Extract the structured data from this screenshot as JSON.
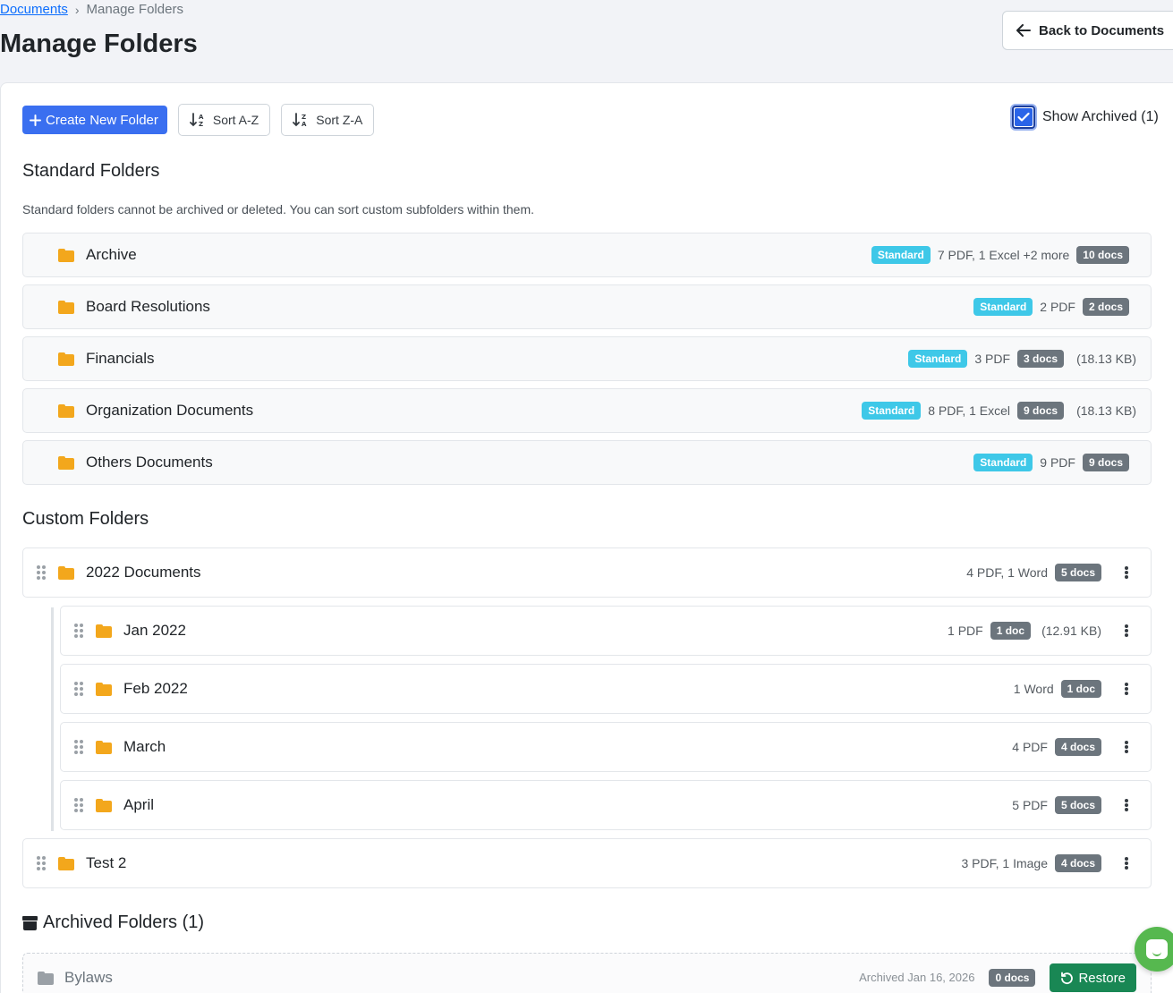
{
  "breadcrumb": {
    "link": "Documents",
    "separator": "›",
    "current": "Manage Folders"
  },
  "page_title": "Manage Folders",
  "back_button": "Back to Documents",
  "toolbar": {
    "create": "Create New Folder",
    "sort_az": "Sort A-Z",
    "sort_za": "Sort Z-A"
  },
  "show_archived": {
    "label": "Show Archived (1)",
    "checked": true
  },
  "standard": {
    "title": "Standard Folders",
    "help": "Standard folders cannot be archived or deleted. You can sort custom subfolders within them.",
    "badge": "Standard",
    "folders": [
      {
        "name": "Archive",
        "summary": "7 PDF, 1 Excel +2 more",
        "count": "10 docs",
        "size": ""
      },
      {
        "name": "Board Resolutions",
        "summary": "2 PDF",
        "count": "2 docs",
        "size": ""
      },
      {
        "name": "Financials",
        "summary": "3 PDF",
        "count": "3 docs",
        "size": "(18.13 KB)"
      },
      {
        "name": "Organization Documents",
        "summary": "8 PDF, 1 Excel",
        "count": "9 docs",
        "size": "(18.13 KB)"
      },
      {
        "name": "Others Documents",
        "summary": "9 PDF",
        "count": "9 docs",
        "size": ""
      }
    ]
  },
  "custom": {
    "title": "Custom Folders",
    "folders": [
      {
        "name": "2022 Documents",
        "summary": "4 PDF, 1 Word",
        "count": "5 docs",
        "size": ""
      },
      {
        "name": "Jan 2022",
        "summary": "1 PDF",
        "count": "1 doc",
        "size": "(12.91 KB)"
      },
      {
        "name": "Feb 2022",
        "summary": "1 Word",
        "count": "1 doc",
        "size": ""
      },
      {
        "name": "March",
        "summary": "4 PDF",
        "count": "4 docs",
        "size": ""
      },
      {
        "name": "April",
        "summary": "5 PDF",
        "count": "5 docs",
        "size": ""
      },
      {
        "name": "Test 2",
        "summary": "3 PDF, 1 Image",
        "count": "4 docs",
        "size": ""
      }
    ]
  },
  "archived": {
    "title": "Archived Folders (1)",
    "folders": [
      {
        "name": "Bylaws",
        "archived_on": "Archived Jan 16, 2026",
        "count": "0 docs",
        "restore": "Restore"
      }
    ]
  },
  "colors": {
    "primary": "#3a6ff0",
    "standard_badge": "#3ec8e8",
    "doc_badge": "#6c757d",
    "folder": "#f3a71c",
    "restore": "#198754"
  },
  "icons": [
    "arrow-left-icon",
    "plus-icon",
    "sort-az-icon",
    "sort-za-icon",
    "folder-icon",
    "drag-handle-icon",
    "kebab-menu-icon",
    "archive-box-icon",
    "restore-icon",
    "chat-icon"
  ]
}
